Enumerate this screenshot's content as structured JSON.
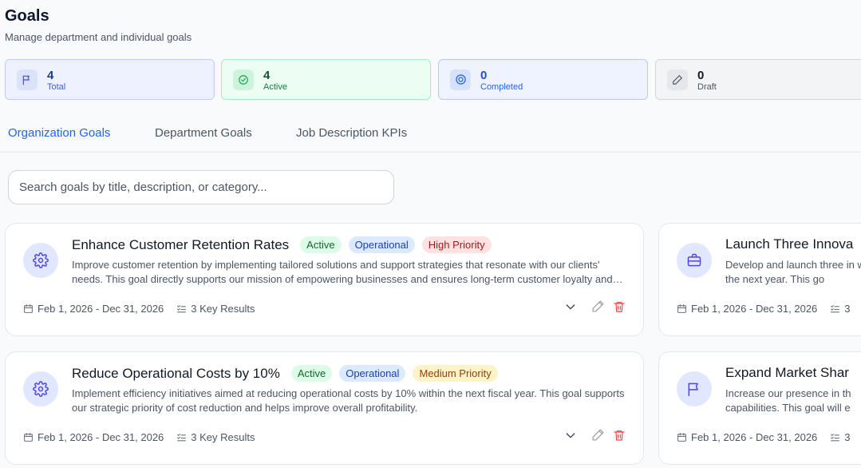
{
  "header": {
    "title": "Goals",
    "subtitle": "Manage department and individual goals"
  },
  "stats": {
    "total": {
      "value": "4",
      "label": "Total",
      "icon": "flag-icon"
    },
    "active": {
      "value": "4",
      "label": "Active",
      "icon": "check-circle-icon"
    },
    "completed": {
      "value": "0",
      "label": "Completed",
      "icon": "badge-check-icon"
    },
    "draft": {
      "value": "0",
      "label": "Draft",
      "icon": "pencil-icon"
    }
  },
  "tabs": [
    {
      "label": "Organization Goals",
      "active": true
    },
    {
      "label": "Department Goals",
      "active": false
    },
    {
      "label": "Job Description KPIs",
      "active": false
    }
  ],
  "search": {
    "placeholder": "Search goals by title, description, or category...",
    "value": ""
  },
  "goals": [
    {
      "icon": "gear-icon",
      "title": "Enhance Customer Retention Rates",
      "status": "Active",
      "category": "Operational",
      "priority": "High Priority",
      "description": "Improve customer retention by implementing tailored solutions and support strategies that resonate with our clients' needs. This goal directly supports our mission of empowering businesses and ensures long-term customer loyalty and growth.",
      "dates": "Feb 1, 2026 - Dec 31, 2026",
      "key_results": "3 Key Results"
    },
    {
      "icon": "briefcase-icon",
      "title": "Launch Three Innova",
      "description": "Develop and launch three in within the next year. This go",
      "dates": "Feb 1, 2026 - Dec 31, 2026",
      "key_results": "3"
    },
    {
      "icon": "gear-icon",
      "title": "Reduce Operational Costs by 10%",
      "status": "Active",
      "category": "Operational",
      "priority": "Medium Priority",
      "description": "Implement efficiency initiatives aimed at reducing operational costs by 10% within the next fiscal year. This goal supports our strategic priority of cost reduction and helps improve overall profitability.",
      "dates": "Feb 1, 2026 - Dec 31, 2026",
      "key_results": "3 Key Results"
    },
    {
      "icon": "flag-icon",
      "title": "Expand Market Shar",
      "description": "Increase our presence in th capabilities. This goal will e",
      "dates": "Feb 1, 2026 - Dec 31, 2026",
      "key_results": "3"
    }
  ],
  "colors": {
    "accent": "#2563eb",
    "icon_primary": "#4f46e5",
    "delete": "#ef4444"
  }
}
